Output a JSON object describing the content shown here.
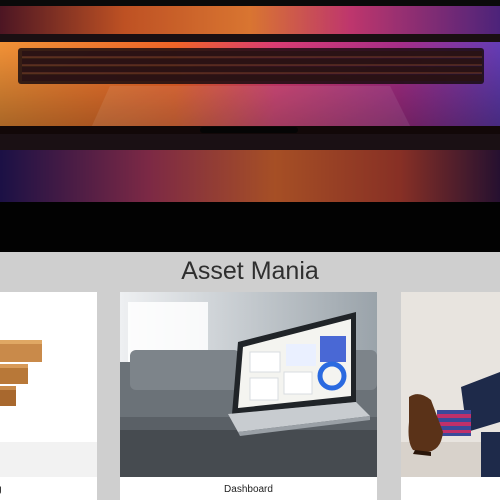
{
  "site": {
    "title": "Asset Mania"
  },
  "cards": [
    {
      "id": "left",
      "label": "g",
      "image": "wooden-steps-photo"
    },
    {
      "id": "mid",
      "label": "Dashboard",
      "image": "laptop-dashboard-photo"
    },
    {
      "id": "right",
      "label": "",
      "image": "person-shoes-photo"
    }
  ],
  "hero": {
    "image": "laptop-keyboard-gradient-photo"
  },
  "colors": {
    "page_bg": "#cfcfcf",
    "card_bg": "#ffffff",
    "title_text": "#2f2f2f",
    "hero_orange": "#ff7a2a",
    "hero_magenta": "#c0207a",
    "hero_purple": "#4b2a8a"
  }
}
